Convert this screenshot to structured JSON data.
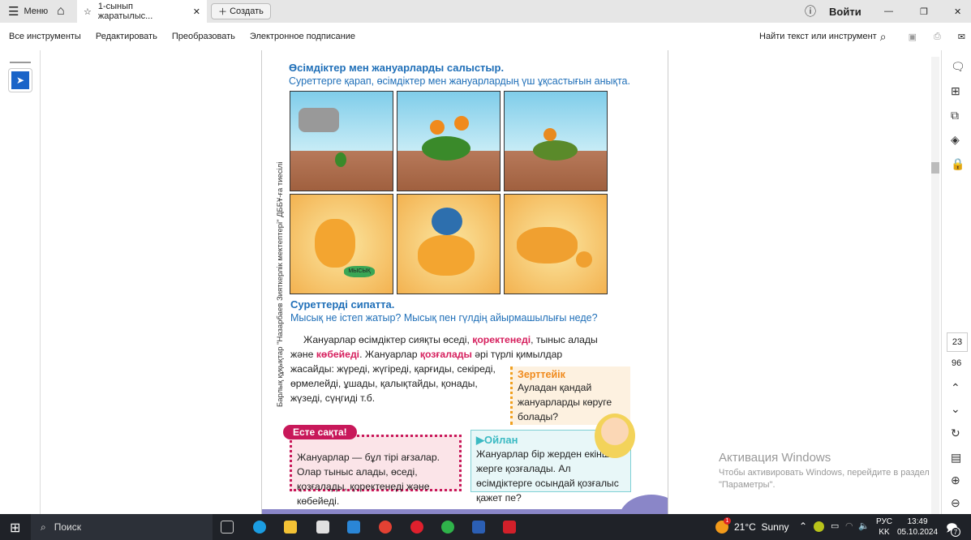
{
  "tabbar": {
    "menu": "Меню",
    "tab_title": "1-сынып жаратылыс...",
    "create": "Создать",
    "login": "Войти"
  },
  "toolbar": {
    "items": [
      "Все инструменты",
      "Редактировать",
      "Преобразовать",
      "Электронное подписание"
    ],
    "find": "Найти текст или инструмент"
  },
  "page": {
    "title": "Өсімдіктер мен жануарларды салыстыр.",
    "subtitle": "Суреттерге қарап, өсімдіктер мен жануарлардың үш ұқсастығын анықта.",
    "side_text": "Барлық құқықтар \"Назарбаев Зияткерлік мектептері\" ДББҰ-ға тиесілі",
    "bowl_label": "МЫСЫҚ",
    "describe_title": "Суреттерді сипатта.",
    "describe_q": "Мысық не істеп жатыр? Мысық пен гүлдің айырмашылығы неде?",
    "p1": "Жануарлар өсімдіктер сияқты өседі, ",
    "p1_red": "қоректенеді",
    "p1b": ", тыныс алады",
    "p2": "және ",
    "p2_red": "көбейеді",
    "p2b": ". Жануарлар ",
    "p2_red2": "қозғалады",
    "p2c": " әрі түрлі қимылдар",
    "p3": "жасайды: жүреді, жүгіреді, қарғиды, секіреді,",
    "p4": "өрмелейді, ұшады, қалықтайды, қонады,",
    "p5": "жүзеді, сүңгиді т.б.",
    "explore_title": "Зерттейік",
    "explore_text": "Ауладан қандай жануарларды көруге болады?",
    "remember_title": "Есте сақта!",
    "remember_text": "Жануарлар — бұл тірі ағзалар. Олар тыныс алады, өседі, қозғалады, қоректенеді және көбейеді.",
    "think_title": "Ойлан",
    "think_text": "Жануарлар бір жерден екінші жерге қозғалады. Ал өсімдіктерге осындай қозғалыс қажет пе?"
  },
  "pager": {
    "current": "23",
    "total": "96"
  },
  "watermark": {
    "title": "Активация Windows",
    "line1": "Чтобы активировать Windows, перейдите в раздел",
    "line2": "\"Параметры\"."
  },
  "taskbar": {
    "search": "Поиск",
    "weather": "21°C  Sunny",
    "weather_badge": "1",
    "lang1": "РУС",
    "lang2": "KK",
    "time": "13:49",
    "date": "05.10.2024",
    "notif": "7"
  }
}
